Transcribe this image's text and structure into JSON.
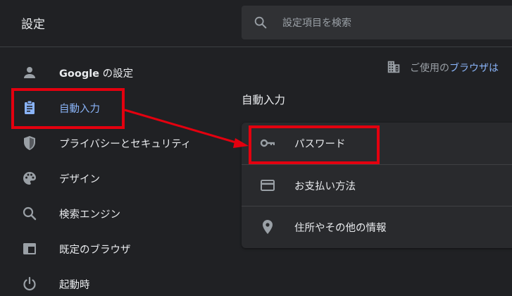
{
  "header": {
    "title": "設定",
    "search_placeholder": "設定項目を検索"
  },
  "sidebar": {
    "items": [
      {
        "icon": "person-icon",
        "label_bold": "Google",
        "label_rest": " の設定",
        "active": false
      },
      {
        "icon": "assignment-icon",
        "label": "自動入力",
        "active": true
      },
      {
        "icon": "shield-icon",
        "label": "プライバシーとセキュリティ",
        "active": false
      },
      {
        "icon": "palette-icon",
        "label": "デザイン",
        "active": false
      },
      {
        "icon": "search-icon",
        "label": "検索エンジン",
        "active": false
      },
      {
        "icon": "browser-window-icon",
        "label": "既定のブラウザ",
        "active": false
      },
      {
        "icon": "power-icon",
        "label": "起動時",
        "active": false
      }
    ]
  },
  "main": {
    "managed_notice": {
      "prefix": "ご使用の",
      "link": "ブラウザは"
    },
    "section_title": "自動入力",
    "rows": [
      {
        "icon": "key-icon",
        "label": "パスワード"
      },
      {
        "icon": "credit-card-icon",
        "label": "お支払い方法"
      },
      {
        "icon": "location-pin-icon",
        "label": "住所やその他の情報"
      }
    ]
  },
  "colors": {
    "background": "#202124",
    "accent": "#8ab4f8",
    "annotation": "#e3000f"
  }
}
